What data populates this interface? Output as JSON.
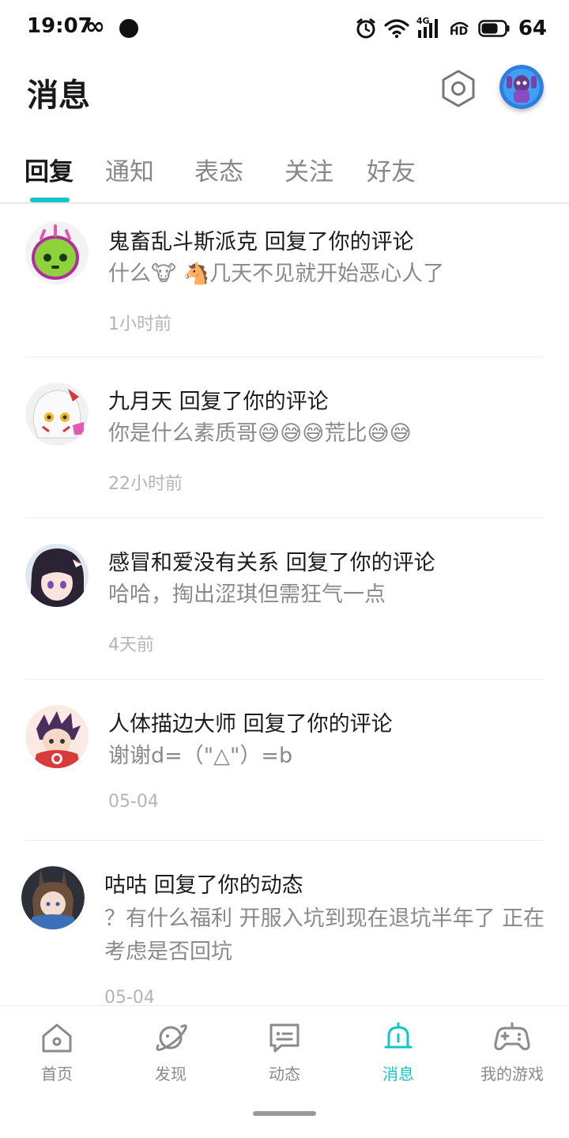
{
  "status_bar": {
    "time": "19:07",
    "network": "4G",
    "hd": "HD",
    "battery": "64",
    "icons": [
      "infinity-icon",
      "notification-dot-icon",
      "alarm-icon",
      "wifi-icon",
      "signal-icon",
      "hd-icon",
      "battery-icon"
    ]
  },
  "header": {
    "title": "消息"
  },
  "tabs": [
    {
      "label": "回复",
      "active": true
    },
    {
      "label": "通知",
      "active": false
    },
    {
      "label": "表态",
      "active": false
    },
    {
      "label": "关注",
      "active": false
    },
    {
      "label": "好友",
      "active": false
    }
  ],
  "messages": [
    {
      "title": "鬼畜乱斗斯派克 回复了你的评论",
      "body": "什么🐮 🐴几天不见就开始恶心人了",
      "time": "1小时前"
    },
    {
      "title": "九月天 回复了你的评论",
      "body": "你是什么素质哥😅😅😅荒比😅😅",
      "time": "22小时前"
    },
    {
      "title": "感冒和爱没有关系 回复了你的评论",
      "body": "哈哈，掏出涩琪但需狂气一点",
      "time": "4天前"
    },
    {
      "title": "人体描边大师 回复了你的评论",
      "body": "谢谢d=（\"△\"）=b",
      "time": "05-04"
    },
    {
      "title": "咕咕 回复了你的动态",
      "body": "？有什么福利 开服入坑到现在退坑半年了 正在考虑是否回坑",
      "time": "05-04"
    }
  ],
  "bottom_nav": [
    {
      "label": "首页",
      "icon": "home-icon",
      "active": false
    },
    {
      "label": "发现",
      "icon": "planet-icon",
      "active": false
    },
    {
      "label": "动态",
      "icon": "chat-icon",
      "active": false
    },
    {
      "label": "消息",
      "icon": "bell-icon",
      "active": true
    },
    {
      "label": "我的游戏",
      "icon": "gamepad-icon",
      "active": false
    }
  ],
  "colors": {
    "accent": "#14c5c8",
    "text_primary": "#1c1c1c",
    "text_secondary": "#8a8a8a",
    "text_tertiary": "#b5b5b5"
  }
}
